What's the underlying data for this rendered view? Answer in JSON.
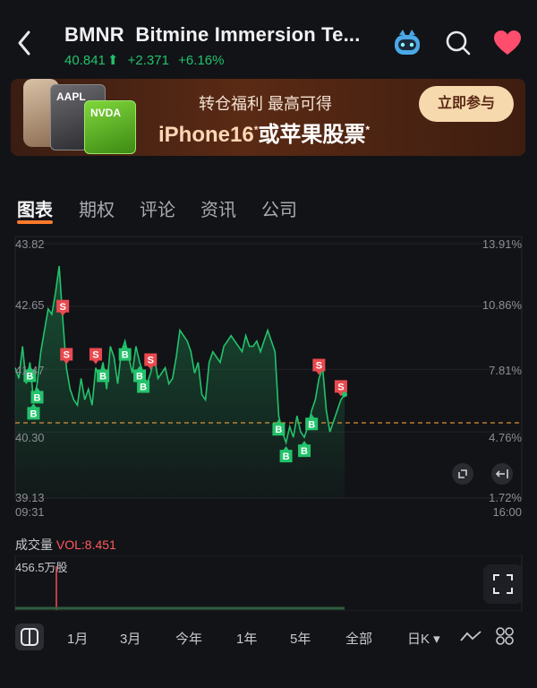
{
  "header": {
    "symbol": "BMNR",
    "name": "Bitmine Immersion Te...",
    "price": "40.841",
    "change": "+2.371",
    "change_pct": "+6.16%",
    "icons": [
      "back-icon",
      "robot-assistant-icon",
      "search-icon",
      "favorite-heart-icon"
    ]
  },
  "banner": {
    "line1": "转仓福利 最高可得",
    "line2_a": "iPhone16",
    "line2_star": "*",
    "line2_b": "或苹果股票",
    "line2_star2": "*",
    "cta": "立即参与",
    "card1": "AAPL",
    "card2": "NVDA"
  },
  "tabs": [
    {
      "label": "图表",
      "active": true
    },
    {
      "label": "期权",
      "active": false
    },
    {
      "label": "评论",
      "active": false
    },
    {
      "label": "资讯",
      "active": false
    },
    {
      "label": "公司",
      "active": false
    }
  ],
  "chart": {
    "left_ticks": [
      "43.82",
      "42.65",
      "41.47",
      "40.30",
      "39.13"
    ],
    "right_ticks": [
      "13.91%",
      "10.86%",
      "7.81%",
      "4.76%",
      "1.72%"
    ],
    "time_start": "09:31",
    "time_end": "16:00",
    "prev_close": 40.47,
    "accent": "#23c26b",
    "sell_color": "#e84a4f"
  },
  "chart_data": {
    "type": "line",
    "ylim": [
      39.13,
      43.82
    ],
    "y": [
      41.5,
      41.3,
      41.9,
      41.2,
      41.6,
      40.9,
      41.2,
      41.8,
      42.2,
      42.6,
      42.5,
      42.9,
      43.4,
      42.4,
      41.5,
      41.1,
      40.9,
      40.8,
      41.3,
      40.9,
      41.1,
      40.8,
      41.5,
      41.3,
      41.6,
      41.1,
      41.9,
      41.7,
      41.2,
      41.8,
      42.0,
      41.7,
      41.4,
      41.9,
      41.6,
      41.4,
      41.2,
      41.4,
      41.7,
      41.3,
      41.4,
      41.5,
      41.2,
      41.3,
      41.7,
      42.2,
      42.1,
      42.0,
      41.8,
      41.4,
      41.6,
      41.0,
      40.9,
      41.6,
      41.8,
      41.7,
      41.6,
      41.9,
      42.0,
      42.1,
      42.0,
      41.9,
      41.8,
      42.1,
      41.9,
      41.9,
      42.0,
      41.8,
      42.0,
      42.2,
      42.0,
      41.8,
      40.6,
      40.3,
      40.1,
      40.4,
      40.2,
      40.6,
      40.3,
      40.2,
      40.4,
      40.7,
      40.9,
      41.3,
      41.5,
      40.7,
      40.3,
      40.5,
      40.7,
      40.9,
      41.0
    ],
    "markers": [
      {
        "label": "B",
        "idx": 4
      },
      {
        "label": "B",
        "idx": 5
      },
      {
        "label": "B",
        "idx": 6
      },
      {
        "label": "S",
        "idx": 13
      },
      {
        "label": "S",
        "idx": 14
      },
      {
        "label": "S",
        "idx": 22
      },
      {
        "label": "B",
        "idx": 24
      },
      {
        "label": "B",
        "idx": 30
      },
      {
        "label": "B",
        "idx": 34
      },
      {
        "label": "B",
        "idx": 35
      },
      {
        "label": "S",
        "idx": 37
      },
      {
        "label": "B",
        "idx": 72
      },
      {
        "label": "B",
        "idx": 74
      },
      {
        "label": "B",
        "idx": 79
      },
      {
        "label": "B",
        "idx": 81
      },
      {
        "label": "S",
        "idx": 83
      },
      {
        "label": "S",
        "idx": 89
      }
    ]
  },
  "volume": {
    "title": "成交量",
    "value": "VOL:8.451",
    "max_label": "456.5万股"
  },
  "periods": [
    {
      "label": "1月"
    },
    {
      "label": "3月"
    },
    {
      "label": "今年"
    },
    {
      "label": "1年"
    },
    {
      "label": "5年"
    },
    {
      "label": "全部"
    },
    {
      "label": "日K ▾"
    }
  ]
}
